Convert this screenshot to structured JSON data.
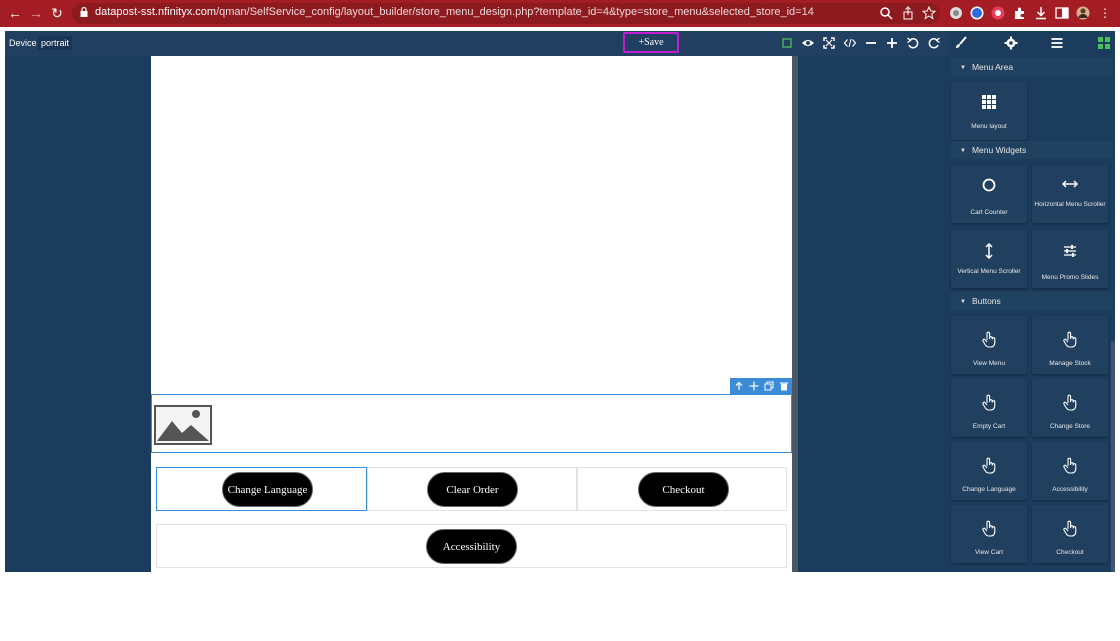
{
  "browser": {
    "url_host": "datapost-sst.nfinityx.com",
    "url_path": "/qman/SelfService_config/layout_builder/store_menu_design.php?template_id=4&type=store_menu&selected_store_id=14"
  },
  "toolbar": {
    "device_label": "Device",
    "device_value": "portrait",
    "save_label": "+Save"
  },
  "canvas": {
    "buttons": [
      {
        "label": "Change Language"
      },
      {
        "label": "Clear Order"
      },
      {
        "label": "Checkout"
      },
      {
        "label": "Accessibility"
      }
    ]
  },
  "panel": {
    "sections": [
      {
        "title": "Menu Area",
        "widgets": [
          {
            "label": "Menu layout",
            "icon": "grid-icon"
          }
        ]
      },
      {
        "title": "Menu Widgets",
        "widgets": [
          {
            "label": "Cart Counter",
            "icon": "circle-icon"
          },
          {
            "label": "Horizontal Menu Scroller",
            "icon": "horizontal-arrows-icon"
          },
          {
            "label": "Vertical Menu Scroller",
            "icon": "vertical-arrows-icon"
          },
          {
            "label": "Menu Promo Slides",
            "icon": "sliders-icon"
          }
        ]
      },
      {
        "title": "Buttons",
        "widgets": [
          {
            "label": "View Menu",
            "icon": "hand-pointer-icon"
          },
          {
            "label": "Manage Stock",
            "icon": "hand-pointer-icon"
          },
          {
            "label": "Empty Cart",
            "icon": "hand-pointer-icon"
          },
          {
            "label": "Change Store",
            "icon": "hand-pointer-icon"
          },
          {
            "label": "Change Language",
            "icon": "hand-pointer-icon"
          },
          {
            "label": "Accessibility",
            "icon": "hand-pointer-icon"
          },
          {
            "label": "View Cart",
            "icon": "hand-pointer-icon"
          },
          {
            "label": "Checkout",
            "icon": "hand-pointer-icon"
          }
        ]
      }
    ]
  },
  "colors": {
    "chrome": "#a51d24",
    "app_bg": "#1c3c5e",
    "selection": "#3b8bd9",
    "save_highlight": "#c11ed6"
  }
}
